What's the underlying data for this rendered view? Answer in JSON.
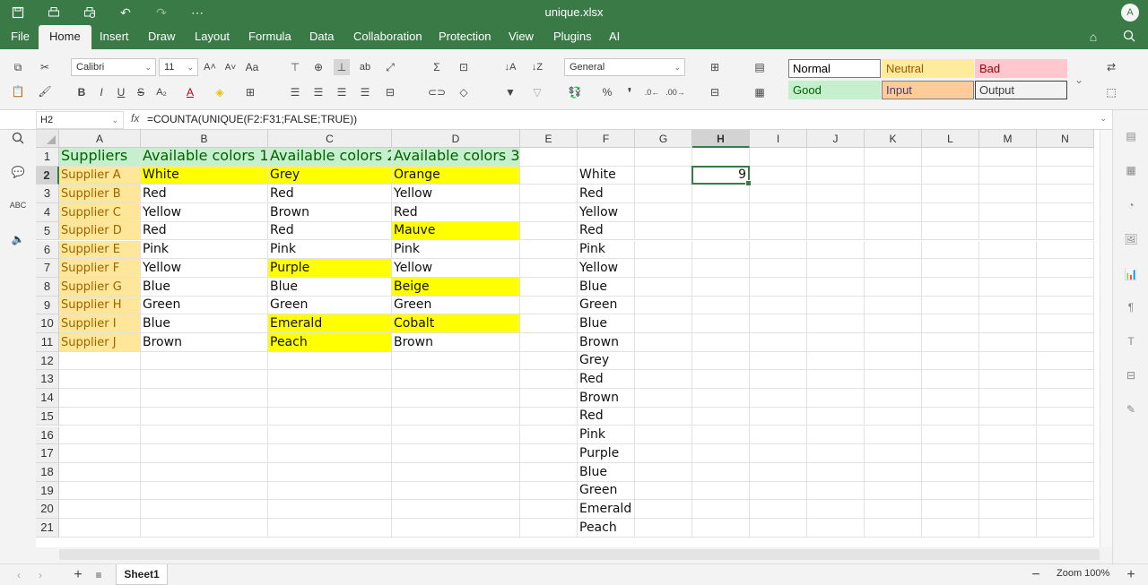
{
  "app": {
    "title": "unique.xlsx",
    "avatar": "A"
  },
  "menu": [
    "File",
    "Home",
    "Insert",
    "Draw",
    "Layout",
    "Formula",
    "Data",
    "Collaboration",
    "Protection",
    "View",
    "Plugins",
    "AI"
  ],
  "ribbon": {
    "font_name": "Calibri",
    "font_size": "11",
    "number_format": "General",
    "styles": [
      {
        "label": "Normal",
        "bg": "#ffffff",
        "color": "#000000",
        "border": "#7a7a7a"
      },
      {
        "label": "Neutral",
        "bg": "#ffeb9c",
        "color": "#9c5700",
        "border": "#ffeb9c"
      },
      {
        "label": "Bad",
        "bg": "#ffc7ce",
        "color": "#9c0006",
        "border": "#ffc7ce"
      },
      {
        "label": "Good",
        "bg": "#c6efce",
        "color": "#006100",
        "border": "#c6efce"
      },
      {
        "label": "Input",
        "bg": "#ffcc99",
        "color": "#3f3f76",
        "border": "#7f7f7f"
      },
      {
        "label": "Output",
        "bg": "#f2f2f2",
        "color": "#3f3f3f",
        "border": "#3f3f3f"
      }
    ]
  },
  "formula_bar": {
    "name_box": "H2",
    "fx": "fx",
    "formula": "=COUNTA(UNIQUE(F2:F31;FALSE;TRUE))"
  },
  "grid": {
    "columns": [
      "A",
      "B",
      "C",
      "D",
      "E",
      "F",
      "G",
      "H",
      "I",
      "J",
      "K",
      "L",
      "M",
      "N"
    ],
    "active_column": "H",
    "active_row": 2,
    "rows": [
      {
        "num": "1",
        "cells": {
          "A": "Suppliers",
          "B": "Available colors 1",
          "C": "Available colors 2",
          "D": "Available colors 3"
        }
      },
      {
        "num": "2",
        "cells": {
          "A": "Supplier A",
          "B": "White",
          "C": "Grey",
          "D": "Orange",
          "F": "White",
          "H": "9"
        }
      },
      {
        "num": "3",
        "cells": {
          "A": "Supplier B",
          "B": "Red",
          "C": "Red",
          "D": "Yellow",
          "F": "Red"
        }
      },
      {
        "num": "4",
        "cells": {
          "A": "Supplier C",
          "B": "Yellow",
          "C": "Brown",
          "D": "Red",
          "F": "Yellow"
        }
      },
      {
        "num": "5",
        "cells": {
          "A": "Supplier D",
          "B": "Red",
          "C": "Red",
          "D": "Mauve",
          "F": "Red"
        }
      },
      {
        "num": "6",
        "cells": {
          "A": "Supplier E",
          "B": "Pink",
          "C": "Pink",
          "D": "Pink",
          "F": "Pink"
        }
      },
      {
        "num": "7",
        "cells": {
          "A": "Supplier F",
          "B": "Yellow",
          "C": "Purple",
          "D": "Yellow",
          "F": "Yellow"
        }
      },
      {
        "num": "8",
        "cells": {
          "A": "Supplier G",
          "B": "Blue",
          "C": "Blue",
          "D": "Beige",
          "F": "Blue"
        }
      },
      {
        "num": "9",
        "cells": {
          "A": "Supplier H",
          "B": "Green",
          "C": "Green",
          "D": "Green",
          "F": "Green"
        }
      },
      {
        "num": "10",
        "cells": {
          "A": "Supplier I",
          "B": "Blue",
          "C": "Emerald",
          "D": "Cobalt",
          "F": "Blue"
        }
      },
      {
        "num": "11",
        "cells": {
          "A": "Supplier J",
          "B": "Brown",
          "C": "Peach",
          "D": "Brown",
          "F": "Brown"
        }
      },
      {
        "num": "12",
        "cells": {
          "F": "Grey"
        }
      },
      {
        "num": "13",
        "cells": {
          "F": "Red"
        }
      },
      {
        "num": "14",
        "cells": {
          "F": "Brown"
        }
      },
      {
        "num": "15",
        "cells": {
          "F": "Red"
        }
      },
      {
        "num": "16",
        "cells": {
          "F": "Pink"
        }
      },
      {
        "num": "17",
        "cells": {
          "F": "Purple"
        }
      },
      {
        "num": "18",
        "cells": {
          "F": "Blue"
        }
      },
      {
        "num": "19",
        "cells": {
          "F": "Green"
        }
      },
      {
        "num": "20",
        "cells": {
          "F": "Emerald"
        }
      },
      {
        "num": "21",
        "cells": {
          "F": "Peach"
        }
      }
    ],
    "colors": {
      "header_fill": "#c6efce",
      "header_text": "#006100",
      "supplier_fill": "#ffe699",
      "supplier_text": "#9c6500",
      "highlight": "#ffff00"
    },
    "highlights": [
      "B2",
      "C2",
      "D2",
      "D5",
      "C7",
      "D8",
      "C10",
      "D10",
      "C11"
    ]
  },
  "status": {
    "sheet_tab": "Sheet1",
    "zoom": "Zoom 100%"
  }
}
